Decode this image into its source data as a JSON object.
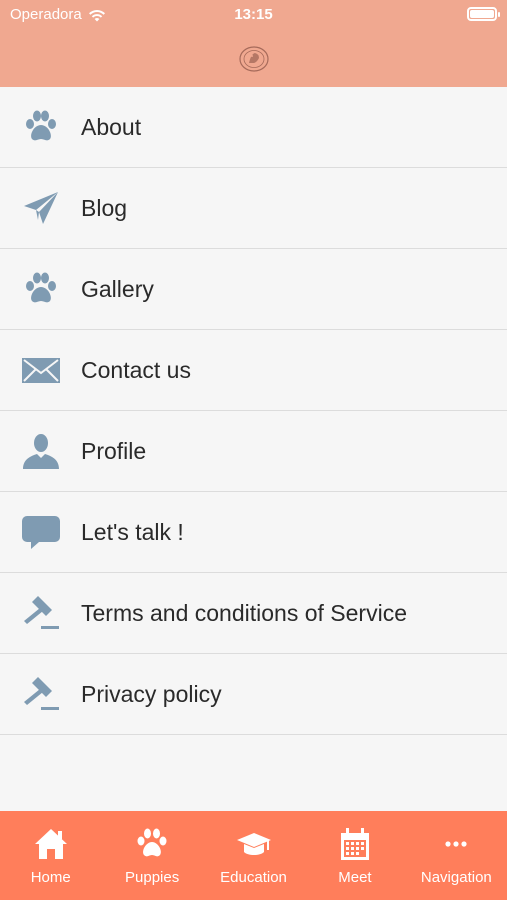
{
  "status_bar": {
    "carrier": "Operadora",
    "time": "13:15"
  },
  "menu": {
    "items": [
      {
        "label": "About",
        "icon": "paw-icon"
      },
      {
        "label": "Blog",
        "icon": "paper-plane-icon"
      },
      {
        "label": "Gallery",
        "icon": "paw-icon"
      },
      {
        "label": "Contact us",
        "icon": "envelope-icon"
      },
      {
        "label": "Profile",
        "icon": "user-icon"
      },
      {
        "label": "Let's talk !",
        "icon": "speech-bubble-icon"
      },
      {
        "label": "Terms and conditions of Service",
        "icon": "gavel-icon"
      },
      {
        "label": "Privacy policy",
        "icon": "gavel-icon"
      }
    ]
  },
  "tabbar": {
    "tabs": [
      {
        "label": "Home",
        "icon": "home-icon"
      },
      {
        "label": "Puppies",
        "icon": "paw-icon"
      },
      {
        "label": "Education",
        "icon": "graduation-cap-icon"
      },
      {
        "label": "Meet",
        "icon": "calendar-icon"
      },
      {
        "label": "Navigation",
        "icon": "more-dots-icon"
      }
    ]
  },
  "colors": {
    "header": "#f0a890",
    "tabbar": "#ff7e5b",
    "icon": "#7f9bb2",
    "background": "#f6f6f6"
  }
}
